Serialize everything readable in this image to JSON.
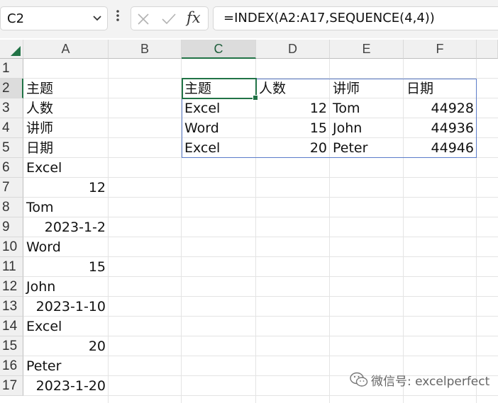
{
  "formula_bar": {
    "name_box": "C2",
    "formula": "=INDEX(A2:A17,SEQUENCE(4,4))",
    "fx_label": "fx"
  },
  "columns": [
    "A",
    "B",
    "C",
    "D",
    "E",
    "F"
  ],
  "selected_column": "C",
  "rows": [
    "1",
    "2",
    "3",
    "4",
    "5",
    "6",
    "7",
    "8",
    "9",
    "10",
    "11",
    "12",
    "13",
    "14",
    "15",
    "16",
    "17"
  ],
  "selected_row": "2",
  "column_a": [
    "主题",
    "人数",
    "讲师",
    "日期",
    "Excel",
    "12",
    "Tom",
    "2023-1-2",
    "Word",
    "15",
    "John",
    "2023-1-10",
    "Excel",
    "20",
    "Peter",
    "2023-1-20"
  ],
  "result_table": [
    [
      "主题",
      "人数",
      "讲师",
      "日期"
    ],
    [
      "Excel",
      "12",
      "Tom",
      "44928"
    ],
    [
      "Word",
      "15",
      "John",
      "44936"
    ],
    [
      "Excel",
      "20",
      "Peter",
      "44946"
    ]
  ],
  "watermark": "微信号: excelperfect",
  "colors": {
    "selection": "#217346",
    "spill_border": "#5b7cc9",
    "header_bg": "#f0f0f0"
  }
}
